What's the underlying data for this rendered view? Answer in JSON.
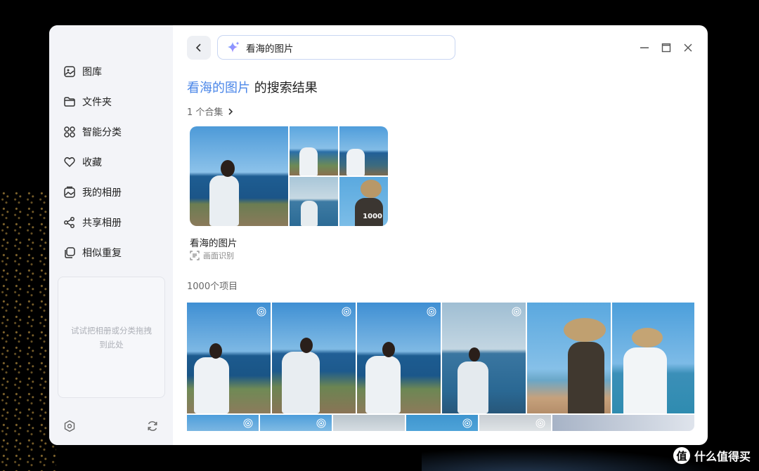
{
  "sidebar": {
    "items": [
      {
        "label": "图库",
        "icon": "gallery-icon"
      },
      {
        "label": "文件夹",
        "icon": "folder-icon"
      },
      {
        "label": "智能分类",
        "icon": "grid-categories-icon"
      },
      {
        "label": "收藏",
        "icon": "heart-icon"
      },
      {
        "label": "我的相册",
        "icon": "album-icon"
      },
      {
        "label": "共享相册",
        "icon": "share-icon"
      },
      {
        "label": "相似重复",
        "icon": "duplicate-icon"
      }
    ],
    "drop_hint": "试试把相册或分类拖拽到此处",
    "bottom_icons": [
      "settings-icon",
      "sync-icon"
    ]
  },
  "search": {
    "query": "看海的图片"
  },
  "result_title": {
    "query": "看海的图片",
    "suffix": " 的搜索结果"
  },
  "collections": {
    "count_label": "1 个合集",
    "items": [
      {
        "name": "看海的图片",
        "count": "1000",
        "tag": "画面识别"
      }
    ]
  },
  "items": {
    "count_label": "1000个项目"
  },
  "watermark": {
    "badge": "值",
    "text": "什么值得买"
  },
  "colors": {
    "accent": "#4a86e8",
    "sidebar_bg": "#f3f4f8",
    "sea": "#1f5f94",
    "sky": "#5aa3dc"
  }
}
